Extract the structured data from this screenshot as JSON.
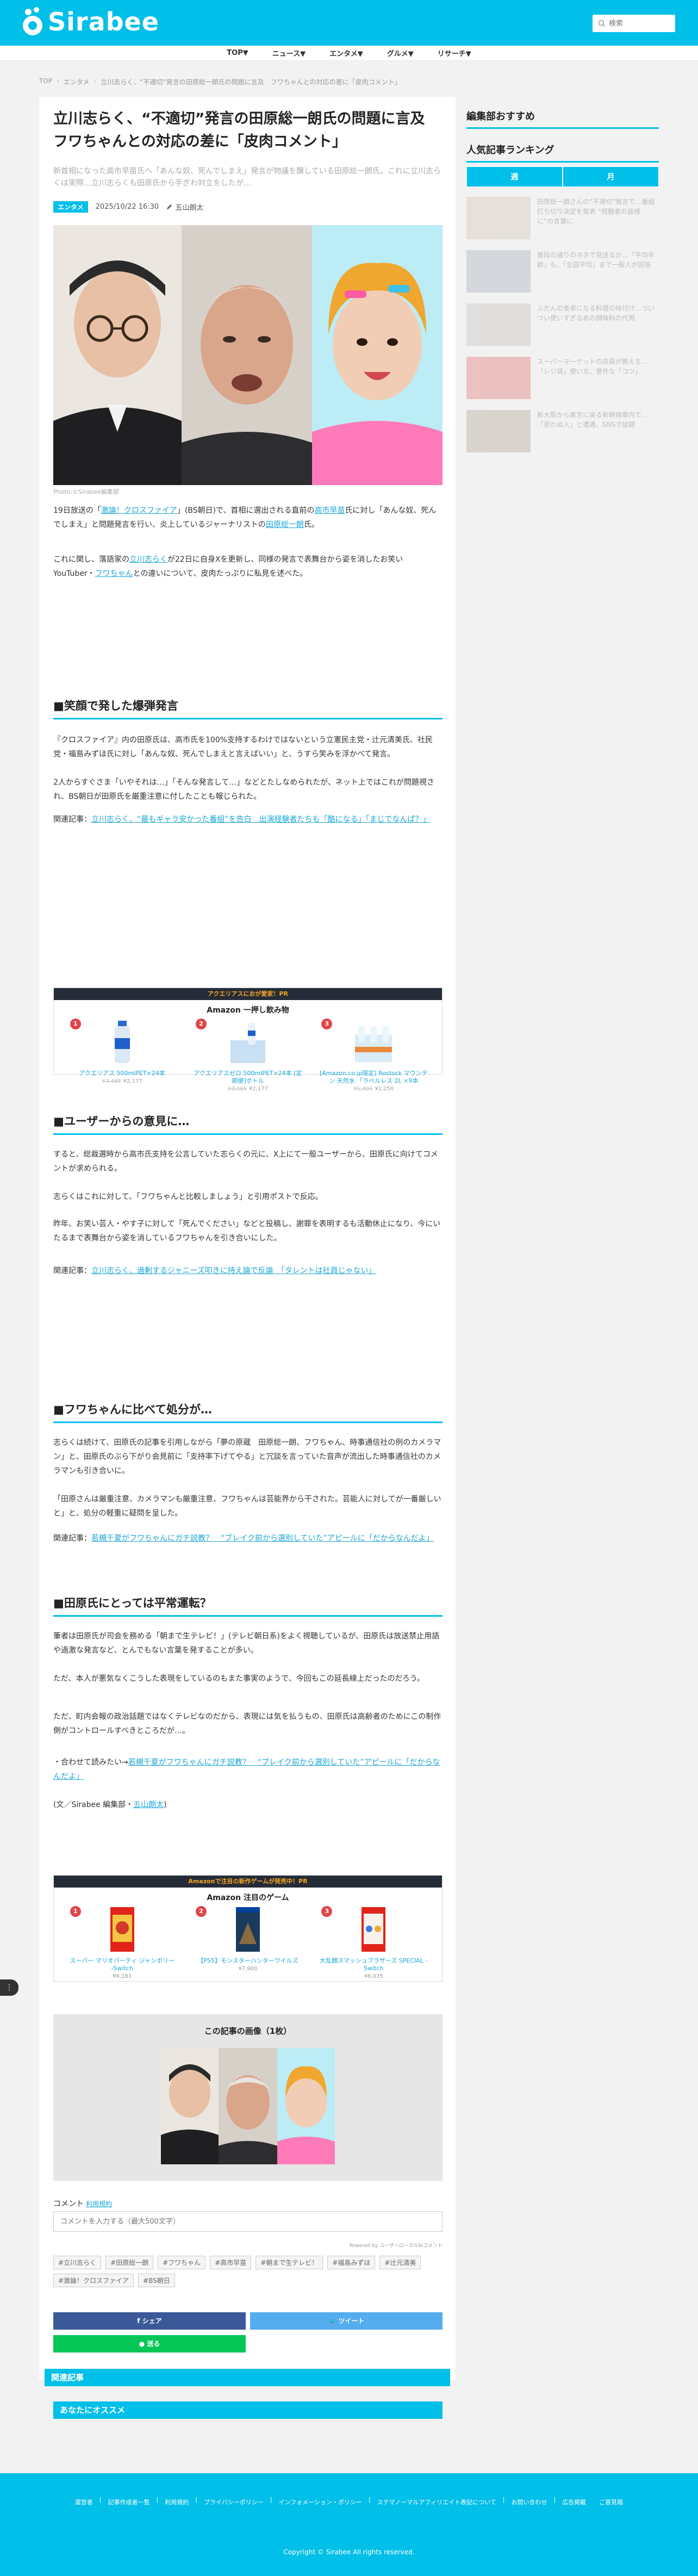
{
  "header": {
    "brand": "Sirabee",
    "search_placeholder": "検索"
  },
  "nav": [
    "TOP▼",
    "ニュース▼",
    "エンタメ▼",
    "グルメ▼",
    "リサーチ▼"
  ],
  "breadcrumb": [
    "TOP",
    "エンタメ",
    "立川志らく、“不適切”発言の田原総一朗氏の問題に言及　フワちゃんとの対応の差に「皮肉コメント」"
  ],
  "article": {
    "title": "立川志らく、“不適切”発言の田原総一朗氏の問題に言及　フワちゃんとの対応の差に「皮肉コメント」",
    "lead": "新首相になった高市早苗氏へ「あんな奴、死んでしまえ」発言が物議を醸している田原総一朗氏。これに立川志らくは実際…立川志らくも田原氏から手ぎわ対立をしたが...",
    "category": "エンタメ",
    "date": "2025/10/22 16:30",
    "author": "五山朗太",
    "photo_credit": "Photo:©Sirabee編集部",
    "p1_pre": "19日放送の「",
    "p1_link1": "激論！クロスファイア",
    "p1_mid": "」(BS朝日)で、首相に選出される直前の",
    "p1_link2": "高市早苗",
    "p1_mid2": "氏に対し「あんな奴、死んでしまえ」と問題発言を行い、炎上しているジャーナリストの",
    "p1_link3": "田原総一朗",
    "p1_end": "氏。",
    "p2_pre": "これに関し、落語家の",
    "p2_link1": "立川志らく",
    "p2_mid": "が22日に自身Xを更新し、同様の発言で表舞台から姿を消したお笑いYouTuber・",
    "p2_link2": "フワちゃん",
    "p2_end": "との違いについて、皮肉たっぷりに私見を述べた。",
    "h_1": "■笑顔で発した爆弾発言",
    "s1_p1": "『クロスファイア』内の田原氏は、高市氏を100%支持するわけではないという立憲民主党・辻元清美氏、社民党・福島みずほ氏に対し「あんな奴、死んでしまえと言えばいい」と、うすら笑みを浮かべて発言。",
    "s1_p2": "2人からすぐさま「いやそれは…」「そんな発言して…」などとたしなめられたが、ネット上ではこれが問題視され、BS朝日が田原氏を厳重注意に付したことも報じられた。",
    "rel1_pre": "関連記事：",
    "rel1_link": "立川志らく、“最もギャラ安かった番組”を告白　出演経験者たちも「酷になる」「まじでなんぱ？」",
    "ad1": {
      "bar": "アクエリアスにおが愛家！PR",
      "title": "Amazon 一押し飲み物",
      "items": [
        {
          "rank": "1",
          "name": "アクエリアス 500mlPET×24本",
          "old": "¥3,465",
          "price": "¥2,177"
        },
        {
          "rank": "2",
          "name": "アクエリアスゼロ 500mlPET×24本 [定期便]ボトル",
          "old": "¥3,465",
          "price": "¥2,177"
        },
        {
          "rank": "3",
          "name": "[Amazon.co.jp限定] Rostock マウンテン 天然水 「ラベルレス 2L ×9本",
          "old": "¥1,404",
          "price": "¥1,250"
        }
      ]
    },
    "h_2": "■ユーザーからの意見に…",
    "s2_p1": "すると、総裁選時から高市氏支持を公言していた志らくの元に、X上にて一般ユーザーから、田原氏に向けてコメントが求められる。",
    "s2_p2": "志らくはこれに対して、「フワちゃんと比較しましょう」と引用ポストで反応。",
    "s2_p3": "昨年、お笑い芸人・やす子に対して「死んでください」などと投稿し、謝罪を表明するも活動休止になり、今にいたるまで表舞台から姿を消しているフワちゃんを引き合いにした。",
    "rel2_pre": "関連記事：",
    "rel2_link": "立川志らく、過剰するジャニーズ叩きに持え論で反論　「タレントは社員じゃない」",
    "h_3": "■フワちゃんに比べて処分が…",
    "s3_p1": "志らくは続けて、田原氏の記事を引用しながら「夢の原蔵　田原総一朗、フワちゃん、時事通信社の例のカメラマン」と、田原氏のぶら下がり会見前に「支持率下げてやる」と冗談を言っていた音声が流出した時事通信社のカメラマンも引き合いに。",
    "s3_p2": "「田原さんは厳重注意、カメラマンも厳重注意、フワちゃんは芸能界から干された。芸能人に対してが一番厳しいと」と、処分の軽重に疑問を呈した。",
    "rel3_pre": "関連記事：",
    "rel3_link": "若槻千夏がフワちゃんにガチ説教？　“ブレイク前から選別していた”アピールに「だからなんだよ」",
    "h_4": "■田原氏にとっては平常運転？",
    "s4_p1": "筆者は田原氏が司会を務める「朝まで生テレビ！」(テレビ朝日系)をよく視聴しているが、田原氏は放送禁止用語や過激な発言など、とんでもない言葉を発することが多い。",
    "s4_p2": "ただ、本人が悪気なくこうした表現をしているのもまた事実のようで、今回もこの延長線上だったのだろう。",
    "s4_p3": "ただ、町内会報の政治話題ではなくテレビなのだから、表現には気を払うもの、田原氏は高齢者のためにこの制作側がコントロールすべきところだが…。",
    "s4_rel_pre": "・合わせて読みたい→",
    "s4_rel_link": "若槻千夏がフワちゃんにガチ説教？　“ブレイク前から選別していた”アピールに「だからなんだよ」",
    "byline_pre": "(文／Sirabee 編集部・",
    "byline_link": "五山朗太",
    "byline_end": ")",
    "ad2": {
      "bar": "Amazonで注目の新作ゲームが発売中！PR",
      "title": "Amazon 注目のゲーム",
      "items": [
        {
          "rank": "1",
          "name": "スーパー マリオパーティ ジャンボリー -Switch",
          "price": "¥6,183"
        },
        {
          "rank": "2",
          "name": "【PS5】モンスターハンターワイルズ",
          "price": "¥7,900"
        },
        {
          "rank": "3",
          "name": "大乱闘スマッシュブラザーズ SPECIAL -Switch",
          "price": "¥6,035"
        }
      ]
    },
    "gallery_title": "この記事の画像（1枚）",
    "comment_label": "コメント",
    "comment_rules": "利用規約",
    "comment_placeholder": "コメントを入力する（最大500文字）",
    "comment_powered": "Powered by ユーザーローカルbiコメント",
    "tags": [
      "#立川志らく",
      "#田原総一朗",
      "#フワちゃん",
      "#高市早苗",
      "#朝まで生テレビ！",
      "#福島みずほ",
      "#辻元清美",
      "#激論！クロスファイア",
      "#BS朝日"
    ],
    "share_fb": "シェア",
    "share_tw": "ツイート",
    "share_line": "送る",
    "related": "関連記事",
    "recommend": "あなたにオススメ"
  },
  "sidebar": {
    "pick_title": "編集部おすすめ",
    "ranking_title": "人気記事ランキング",
    "tabs": [
      "週",
      "月"
    ],
    "items": [
      "田原総一朗さんの“不適切”発言で…番組打ち切り決定を発表 “視聴者の皆様に”の言葉に",
      "普段の通りのネタで見送るか…「平均年齢」も、「全国平均」まで一般人が回答",
      "ふだんの食卓になる料理の味付け…ついつい使いすぎるあの調味料の代用",
      "スーパーマーケットの店員が教える…「レジ袋」使い方、意外な「コツ」",
      "新大阪から東京に戻る新幹線車内で…「思わぬ人」と遭遇、SNSで話題"
    ]
  },
  "footer": {
    "links": [
      "運営者",
      "記事作成者一覧",
      "利用規約",
      "プライバシーポリシー",
      "インフォメーション・ポリシー",
      "ステマノーマルアフィリエイト表記について",
      "お問い合わせ",
      "広告掲載",
      "ご意見箱"
    ],
    "copyright": "Copyright © Sirabee All rights reserved."
  }
}
